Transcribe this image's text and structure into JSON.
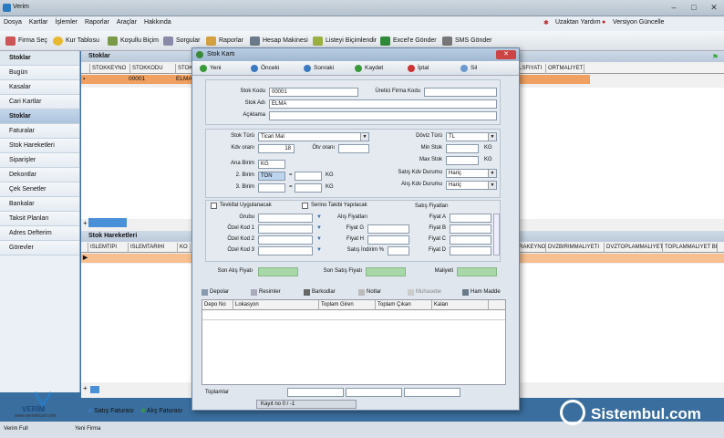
{
  "app": {
    "title": "Verim"
  },
  "menu": {
    "items": [
      "Dosya",
      "Kartlar",
      "İşlemler",
      "Raporlar",
      "Araçlar",
      "Hakkında"
    ],
    "remote_help": "Uzaktan Yardım",
    "version_update": "Versiyon Güncelle"
  },
  "toolbar": {
    "items": [
      "Firma Seç",
      "Kur Tablosu",
      "Koşullu Biçim",
      "Sorgular",
      "Raporlar",
      "Hesap Makinesi",
      "Listeyi Biçimlendir",
      "Excel'e Gönder",
      "SMS Gönder"
    ]
  },
  "sidebar": {
    "items": [
      "Stoklar",
      "Bugün",
      "Kasalar",
      "Cari Kartlar",
      "Stoklar",
      "Faturalar",
      "Stok Hareketleri",
      "Siparişler",
      "Dekontlar",
      "Çek Senetler",
      "Bankalar",
      "Taksit Planları",
      "Adres Defterim",
      "Görevler"
    ]
  },
  "main": {
    "stoklar_title": "Stoklar",
    "stoklar_columns": [
      "STOKKEYNO",
      "STOKKODU",
      "STOK"
    ],
    "stoklar_right_columns": [
      "LSFIYATI",
      "ORTMALIYET"
    ],
    "stoklar_row": {
      "stokkodu": "00001",
      "stok": "ELMA"
    },
    "hareket_title": "Stok Hareketleri",
    "hareket_columns": [
      "ISLEMTIPI",
      "ISLEMTARIHI",
      "KO"
    ],
    "hareket_right_columns": [
      "RAKEYNO",
      "DVZBIRIMMALIYETI",
      "DVZTOPLAMMALIYET",
      "TOPLAMMALIYET BIR"
    ],
    "bottom_buttons": [
      "Satış Faturası",
      "Alış Faturası"
    ]
  },
  "logo": {
    "name": "VERİM",
    "sub": "www.verimticari.com"
  },
  "status": {
    "left": "Verim Full",
    "mid": "Yeni Firma"
  },
  "dialog": {
    "title": "Stok Kartı",
    "toolbar": [
      "Yeni",
      "Önceki",
      "Sonraki",
      "Kaydet",
      "İptal",
      "Sil"
    ],
    "fields": {
      "stok_kodu_label": "Stok Kodu",
      "stok_kodu": "00001",
      "uretici_label": "Üretici Firma Kodu",
      "uretici": "",
      "stok_adi_label": "Stok Adı",
      "stok_adi": "ELMA",
      "aciklama_label": "Açıklama",
      "aciklama": "",
      "stok_turu_label": "Stok Türü",
      "stok_turu": "Ticari Mal",
      "kdv_label": "Kdv oranı",
      "kdv": "18",
      "otv_label": "Ötv oranı",
      "otv": "",
      "doviz_label": "Döviz Türü",
      "doviz": "TL",
      "min_label": "Min Stok",
      "min_unit": "KG",
      "max_label": "Max Stok",
      "max_unit": "KG",
      "satis_kdv_label": "Satış Kdv Durumu",
      "satis_kdv": "Hariç",
      "alis_kdv_label": "Alış Kdv Durumu",
      "alis_kdv": "Hariç",
      "ana_birim_label": "Ana Birim",
      "ana_birim": "KG",
      "birim2_label": "2. Birim",
      "birim2": "TON",
      "birim2_unit": "KG",
      "birim3_label": "3. Birim",
      "birim3_unit": "KG",
      "eq": "="
    },
    "tevkifat": "Tevkifat Uygulanacak",
    "serino": "Serino Takibi Yapılacak",
    "grubu_label": "Grubu",
    "ozel1": "Özel Kod 1",
    "ozel2": "Özel Kod 2",
    "ozel3": "Özel Kod 3",
    "alis_fiyatlari": "Alış Fiyatları",
    "fiyat_g": "Fiyat G",
    "fiyat_h": "Fiyat H",
    "satis_indirim": "Satış İndirim %",
    "satis_fiyatlari": "Satış Fiyatları",
    "fiyat_a": "Fiyat A",
    "fiyat_b": "Fiyat B",
    "fiyat_c": "Fiyat C",
    "fiyat_d": "Fiyat D",
    "son_alis": "Son Alış Fiyatı",
    "son_satis": "Son Satış Fiyatı",
    "maliyeti": "Maliyeti",
    "tabs": [
      "Depolar",
      "Resimler",
      "Barkodlar",
      "Notlar",
      "Muhasebe",
      "Ham Madde"
    ],
    "depo_columns": [
      "Depo No",
      "Lokasyon",
      "Toplam Giren",
      "Toplam Çıkan",
      "Kalan"
    ],
    "toplamlar": "Toplamlar",
    "kayit": "Kayıt no 0 / -1"
  },
  "brand": "Sistembul.com",
  "colors": {
    "selected_row": "#f0a060",
    "accent": "#2a7ac0"
  }
}
